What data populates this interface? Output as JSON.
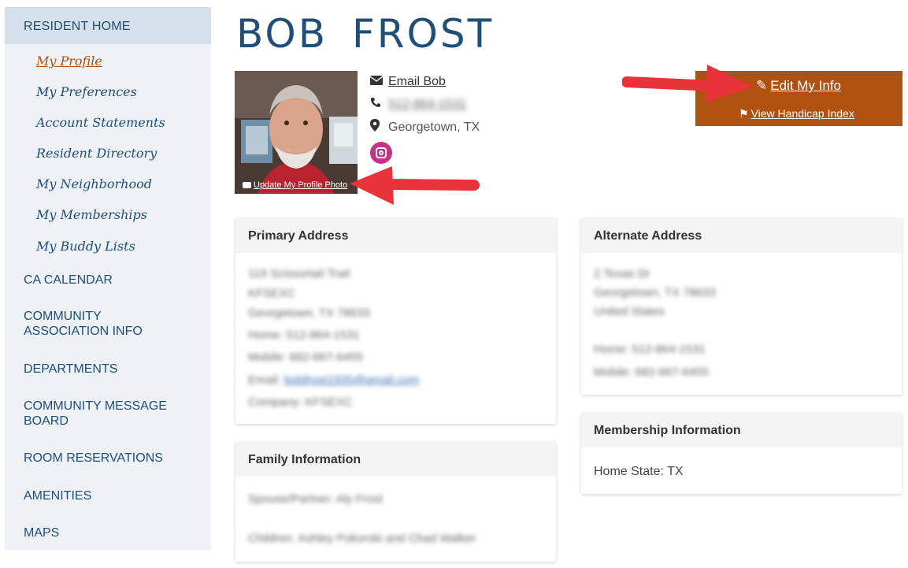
{
  "sidebar": {
    "header": "RESIDENT HOME",
    "sub_items": [
      "My Profile",
      "My Preferences",
      "Account Statements",
      "Resident Directory",
      "My Neighborhood",
      "My Memberships",
      "My Buddy Lists"
    ],
    "main_items": [
      "CA CALENDAR",
      "COMMUNITY ASSOCIATION INFO",
      "DEPARTMENTS",
      "COMMUNITY MESSAGE BOARD",
      "ROOM RESERVATIONS",
      "AMENITIES",
      "MAPS"
    ]
  },
  "profile": {
    "name": "BOB  FROST",
    "photo_caption": "Update My Profile Photo",
    "email_link": "Email Bob",
    "phone": "512-864-1531",
    "location": "Georgetown, TX",
    "instagram_icon": "instagram-icon"
  },
  "actions": {
    "edit_label": "Edit My Info",
    "handicap_label": "View Handicap Index",
    "accent_color": "#b0510f"
  },
  "primary_address": {
    "title": "Primary Address",
    "street": "119 Scissortail Trail",
    "code": "KFSEXC",
    "city": "Georgetown, TX 78633",
    "home": "Home: 512-864-1531",
    "mobile": "Mobile: 682-667-6455",
    "email_label": "Email:",
    "email": "bobfrost1505@gmail.com",
    "company": "Company: KFSEXC"
  },
  "alternate_address": {
    "title": "Alternate Address",
    "street": "2 Texas Dr",
    "city": "Georgetown, TX 78633",
    "country": "United States",
    "home": "Home: 512-864-1531",
    "mobile": "Mobile: 682-667-6455"
  },
  "family": {
    "title": "Family Information",
    "spouse": "Spouse/Partner: Aly Frost",
    "children": "Children: Ashley Pokorski and Chad Walker"
  },
  "membership": {
    "title": "Membership Information",
    "home_state": "Home State: TX"
  }
}
